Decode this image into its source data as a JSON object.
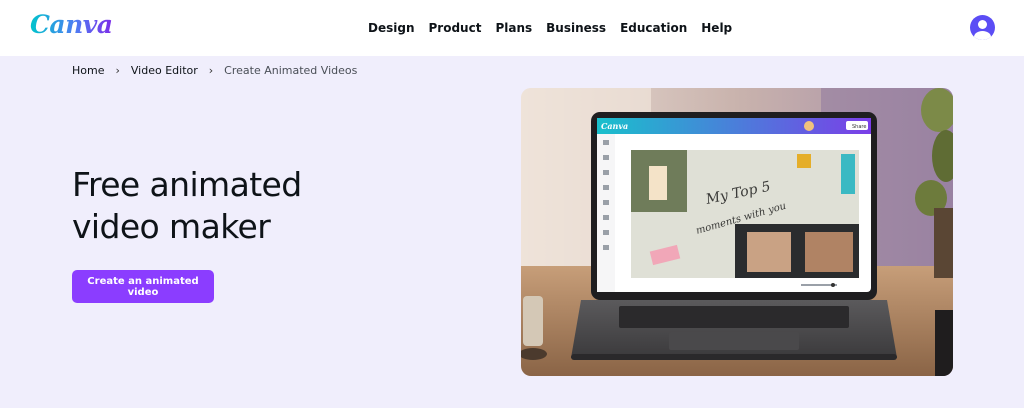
{
  "header": {
    "logo": "Canva",
    "nav": [
      "Design",
      "Product",
      "Plans",
      "Business",
      "Education",
      "Help"
    ]
  },
  "breadcrumb": {
    "items": [
      "Home",
      "Video Editor"
    ],
    "current": "Create Animated Videos"
  },
  "hero": {
    "title": "Free animated video maker",
    "cta_label": "Create an animated video",
    "image": {
      "app_logo": "Canva",
      "share_label": "Share",
      "design_text": [
        "My Top 5",
        "moments with you"
      ]
    }
  },
  "colors": {
    "page_background": "#f0eefc",
    "cta": "#8b3dff",
    "avatar": "#5b4df5"
  }
}
